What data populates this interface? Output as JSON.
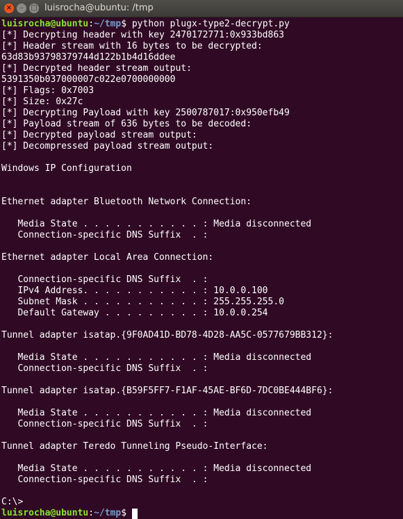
{
  "window": {
    "title": "luisrocha@ubuntu: /tmp"
  },
  "prompt": {
    "user_host": "luisrocha@ubuntu",
    "sep": ":",
    "path": "~/tmp",
    "symbol": "$",
    "command": " python plugx-type2-decrypt.py"
  },
  "output": [
    "[*] Decrypting header with key 2470172771:0x933bd863",
    "[*] Header stream with 16 bytes to be decrypted:",
    "63d83b93798379744d122b1b4d16ddee",
    "[*] Decrypted header stream output:",
    "5391350b037000007c022e0700000000",
    "[*] Flags: 0x7003",
    "[*] Size: 0x27c",
    "[*] Decrypting Payload with key 2500787017:0x950efb49",
    "[*] Payload stream of 636 bytes to be decoded:",
    "[*] Decrypted payload stream output:",
    "[*] Decompressed payload stream output:",
    "",
    "Windows IP Configuration",
    "",
    "",
    "Ethernet adapter Bluetooth Network Connection:",
    "",
    "   Media State . . . . . . . . . . . : Media disconnected",
    "   Connection-specific DNS Suffix  . :",
    "",
    "Ethernet adapter Local Area Connection:",
    "",
    "   Connection-specific DNS Suffix  . :",
    "   IPv4 Address. . . . . . . . . . . : 10.0.0.100",
    "   Subnet Mask . . . . . . . . . . . : 255.255.255.0",
    "   Default Gateway . . . . . . . . . : 10.0.0.254",
    "",
    "Tunnel adapter isatap.{9F0AD41D-BD78-4D28-AA5C-0577679BB312}:",
    "",
    "   Media State . . . . . . . . . . . : Media disconnected",
    "   Connection-specific DNS Suffix  . :",
    "",
    "Tunnel adapter isatap.{B59F5FF7-F1AF-45AE-BF6D-7DC0BE444BF6}:",
    "",
    "   Media State . . . . . . . . . . . : Media disconnected",
    "   Connection-specific DNS Suffix  . :",
    "",
    "Tunnel adapter Teredo Tunneling Pseudo-Interface:",
    "",
    "   Media State . . . . . . . . . . . : Media disconnected",
    "   Connection-specific DNS Suffix  . :",
    "",
    "C:\\>"
  ],
  "colors": {
    "background": "#300a24",
    "prompt_user": "#8ae234",
    "prompt_path": "#729fcf",
    "text": "#ffffff"
  }
}
